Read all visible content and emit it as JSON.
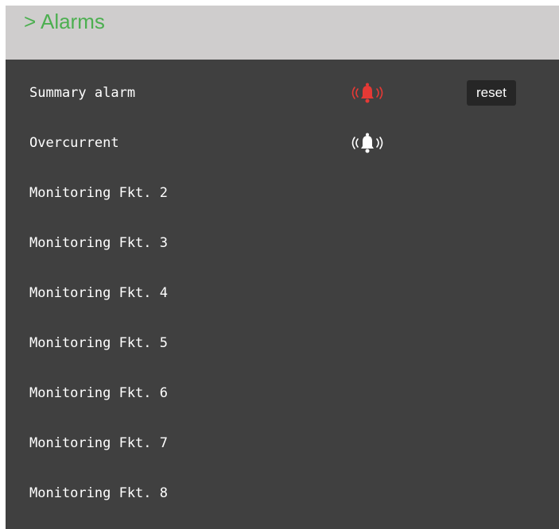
{
  "header": {
    "title": "> Alarms"
  },
  "alarms": [
    {
      "label": "Summary alarm",
      "icon": "bell-ringing-icon",
      "icon_color": "#e53935",
      "reset_label": "reset"
    },
    {
      "label": "Overcurrent",
      "icon": "bell-ringing-icon",
      "icon_color": "#ffffff"
    },
    {
      "label": "Monitoring Fkt. 2"
    },
    {
      "label": "Monitoring Fkt. 3"
    },
    {
      "label": "Monitoring Fkt. 4"
    },
    {
      "label": "Monitoring Fkt. 5"
    },
    {
      "label": "Monitoring Fkt. 6"
    },
    {
      "label": "Monitoring Fkt. 7"
    },
    {
      "label": "Monitoring Fkt. 8"
    }
  ],
  "colors": {
    "title": "#4caf50",
    "panel_bg": "#404040",
    "header_bg": "#cfcdcd",
    "alarm_active": "#e53935",
    "alarm_inactive": "#ffffff"
  }
}
